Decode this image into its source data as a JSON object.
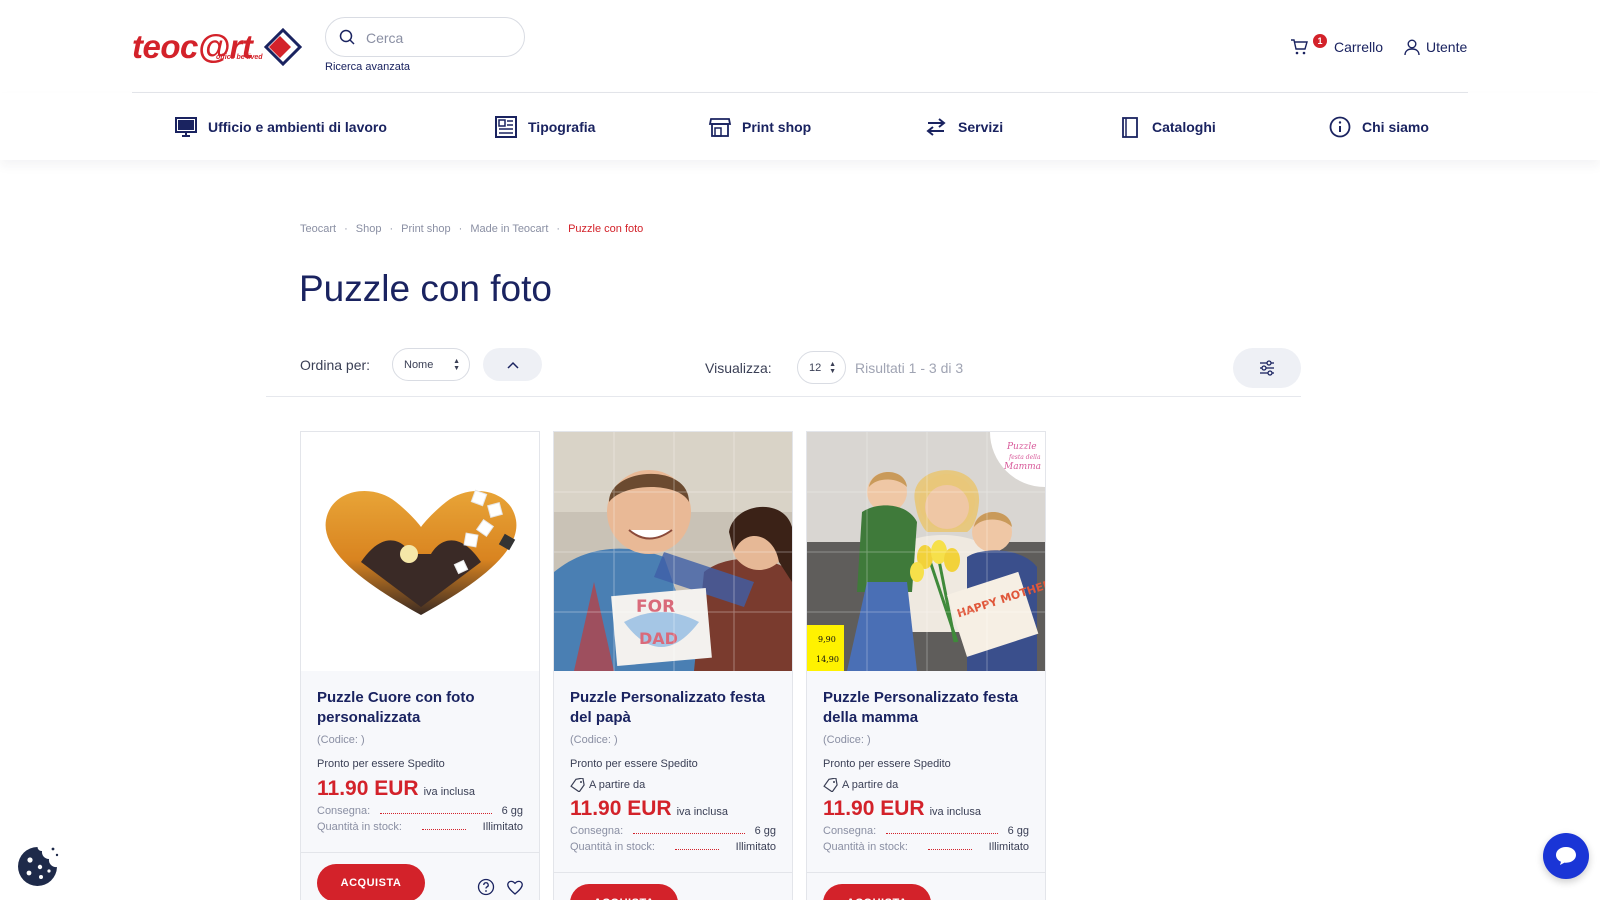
{
  "header": {
    "logo_text": "teoc@rt",
    "logo_tagline": "office be lived",
    "search_placeholder": "Cerca",
    "advanced_search": "Ricerca avanzata",
    "cart_label": "Carrello",
    "cart_count": "1",
    "user_label": "Utente"
  },
  "nav": [
    {
      "label": "Ufficio e ambienti di lavoro",
      "icon": "monitor-icon"
    },
    {
      "label": "Tipografia",
      "icon": "newspaper-icon"
    },
    {
      "label": "Print shop",
      "icon": "store-icon"
    },
    {
      "label": "Servizi",
      "icon": "swap-arrows-icon"
    },
    {
      "label": "Cataloghi",
      "icon": "catalog-icon"
    },
    {
      "label": "Chi siamo",
      "icon": "info-icon"
    }
  ],
  "breadcrumb": [
    "Teocart",
    "Shop",
    "Print shop",
    "Made in Teocart",
    "Puzzle con foto"
  ],
  "page": {
    "title": "Puzzle con foto"
  },
  "toolbar": {
    "sort_label": "Ordina per:",
    "sort_value": "Nome",
    "view_label": "Visualizza:",
    "view_value": "12",
    "results": "Risultati 1 - 3 di 3"
  },
  "products": [
    {
      "name": "Puzzle Cuore con foto personalizzata",
      "code": "(Codice: )",
      "shipping": "Pronto per essere Spedito",
      "price": "11.90 EUR",
      "vat": "iva inclusa",
      "delivery_label": "Consegna:",
      "delivery_value": "6 gg",
      "stock_label": "Quantità in stock:",
      "stock_value": "Illimitato",
      "buy_label": "ACQUISTA"
    },
    {
      "name": "Puzzle Personalizzato festa del papà",
      "code": "(Codice: )",
      "shipping": "Pronto per essere Spedito",
      "from_label": "A partire da",
      "price": "11.90 EUR",
      "vat": "iva inclusa",
      "delivery_label": "Consegna:",
      "delivery_value": "6 gg",
      "stock_label": "Quantità in stock:",
      "stock_value": "Illimitato",
      "buy_label": "ACQUISTA",
      "image_text": "FOR DAD"
    },
    {
      "name": "Puzzle Personalizzato festa della mamma",
      "code": "(Codice: )",
      "shipping": "Pronto per essere Spedito",
      "from_label": "A partire da",
      "price": "11.90 EUR",
      "vat": "iva inclusa",
      "delivery_label": "Consegna:",
      "delivery_value": "6 gg",
      "stock_label": "Quantità in stock:",
      "stock_value": "Illimitato",
      "buy_label": "ACQUISTA",
      "image_badge": "Puzzle festa della Mamma",
      "image_sticker_1": "9,90",
      "image_sticker_2": "14,90",
      "image_text": "HAPPY MOTHER'S DAY"
    }
  ],
  "colors": {
    "brand_red": "#d3222a",
    "navy": "#1a2360",
    "chat_blue": "#1a35d6"
  }
}
